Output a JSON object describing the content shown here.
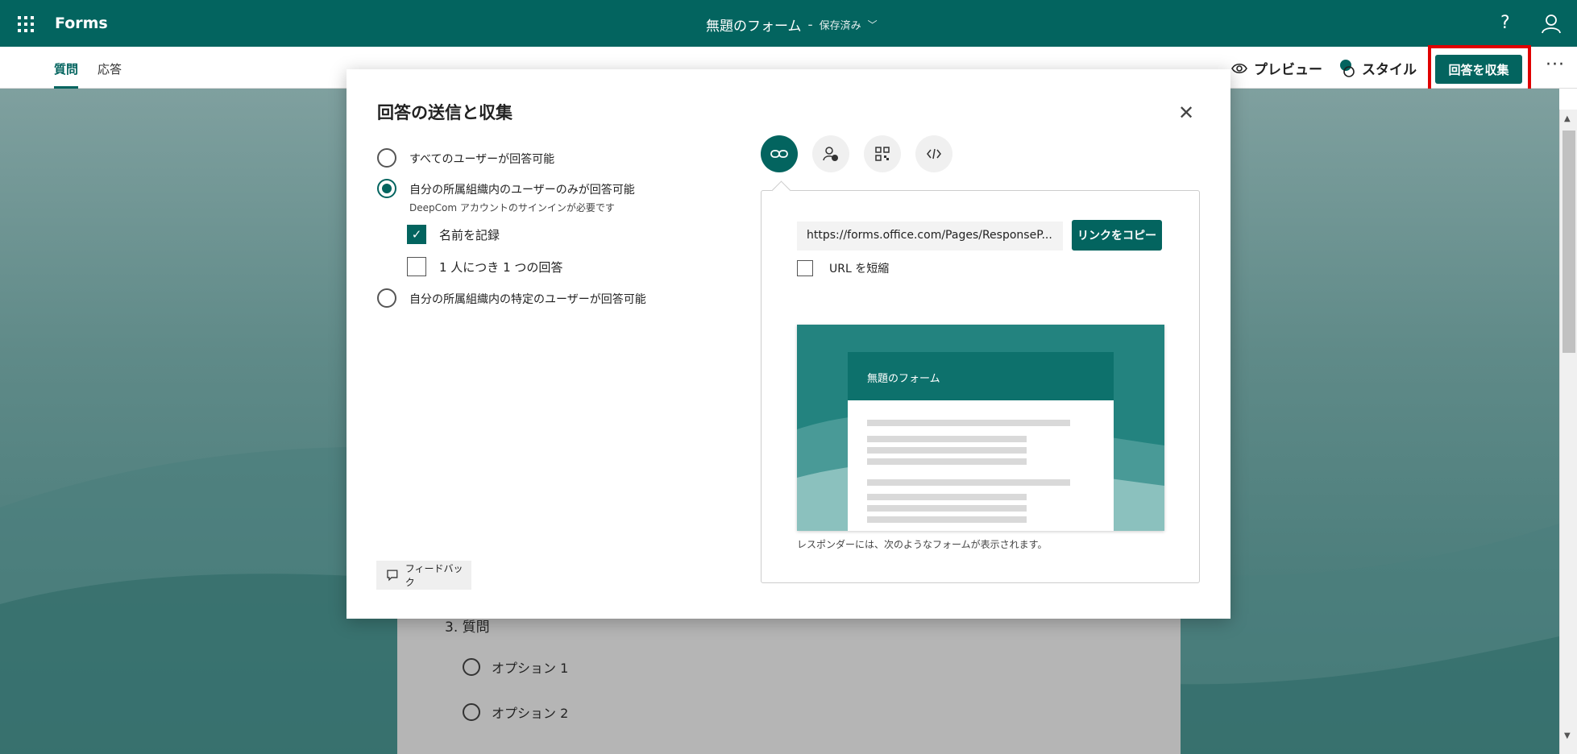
{
  "header": {
    "app_name": "Forms",
    "form_title": "無題のフォーム",
    "title_separator": "-",
    "save_status": "保存済み",
    "help": "?"
  },
  "subbar": {
    "tabs": [
      {
        "label": "質問"
      },
      {
        "label": "応答"
      }
    ],
    "preview_label": "プレビュー",
    "style_label": "スタイル",
    "collect_label": "回答を収集",
    "more": "···"
  },
  "background_form": {
    "question": "3. 質問",
    "options": [
      "オプション 1",
      "オプション 2"
    ]
  },
  "modal": {
    "title": "回答の送信と収集",
    "radio_options": [
      {
        "label": "すべてのユーザーが回答可能",
        "sublabel": "",
        "checked": false
      },
      {
        "label": "自分の所属組織内のユーザーのみが回答可能",
        "sublabel": "DeepCom アカウントのサインインが必要です",
        "checked": true
      },
      {
        "label": "自分の所属組織内の特定のユーザーが回答可能",
        "sublabel": "",
        "checked": false
      }
    ],
    "checkboxes": [
      {
        "label": "名前を記録",
        "checked": true
      },
      {
        "label": "1 人につき 1 つの回答",
        "checked": false
      }
    ],
    "feedback_label": "フィードバック",
    "share": {
      "url": "https://forms.office.com/Pages/ResponseP...",
      "copy_label": "リンクをコピー",
      "shorten_label": "URL を短縮",
      "preview_title": "無題のフォーム",
      "preview_caption": "レスポンダーには、次のようなフォームが表示されます。"
    }
  },
  "colors": {
    "brand": "#03645f",
    "highlight": "#e00000"
  }
}
